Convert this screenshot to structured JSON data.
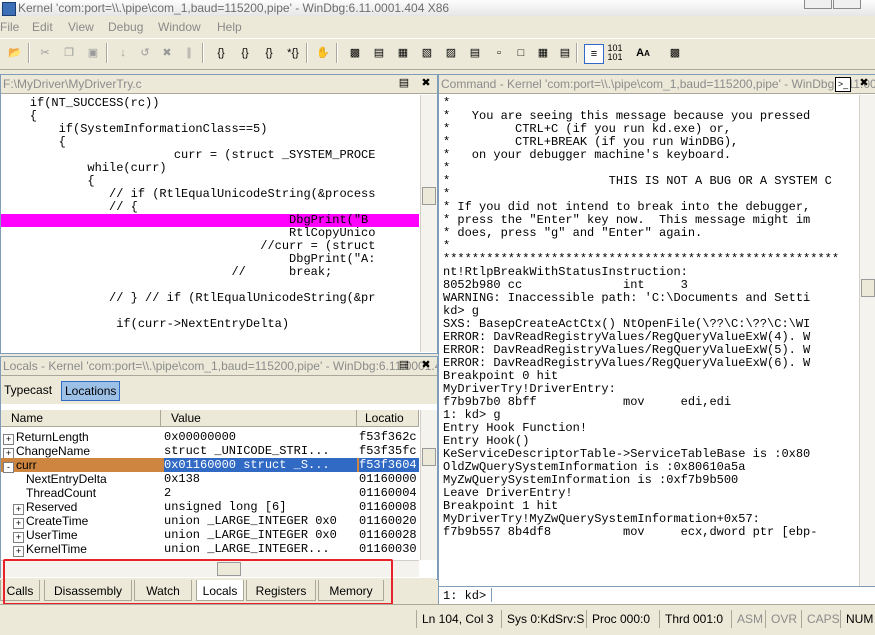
{
  "window": {
    "title": "Kernel 'com:port=\\\\.\\pipe\\com_1,baud=115200,pipe' - WinDbg:6.11.0001.404 X86"
  },
  "menu": [
    "File",
    "Edit",
    "View",
    "Debug",
    "Window",
    "Help"
  ],
  "toolbar": {
    "icons": [
      "open-folder-icon",
      "cut-icon",
      "copy-icon",
      "paste-icon",
      "go-icon",
      "restart-icon",
      "stop-icon",
      "break-icon",
      "step-into-icon",
      "step-over-icon",
      "step-out-icon",
      "run-to-cursor-icon",
      "hand-icon",
      "command-window-icon",
      "watch-window-icon",
      "locals-window-icon",
      "registers-window-icon",
      "memory-window-icon",
      "call-stack-icon",
      "disassembly-icon",
      "scratch-pad-icon",
      "process-threads-icon",
      "source-mode-icon",
      "hex-mode-icon",
      "font-icon",
      "options-icon"
    ]
  },
  "source": {
    "title": "F:\\MyDriver\\MyDriverTry.c",
    "lines": [
      "    if(NT_SUCCESS(rc))",
      "    {",
      "        if(SystemInformationClass==5)",
      "        {",
      "                        curr = (struct _SYSTEM_PROCE",
      "            while(curr)",
      "            {",
      "               // if (RtlEqualUnicodeString(&process",
      "               // {",
      "                                        DbgPrint(\"B",
      "                                        RtlCopyUnico",
      "                                    //curr = (struct",
      "                                        DbgPrint(\"A:",
      "                                //      break;",
      "",
      "               // } // if (RtlEqualUnicodeString(&pr",
      "",
      "                if(curr->NextEntryDelta)"
    ],
    "highlight_line": 9,
    "highlight_color": "#ff00ff"
  },
  "command": {
    "title": "Command - Kernel 'com:port=\\\\.\\pipe\\com_1,baud=115200,pipe' - WinDbg:6.11.0001.404 X86",
    "lines": [
      "*",
      "*   You are seeing this message because you pressed",
      "*         CTRL+C (if you run kd.exe) or,",
      "*         CTRL+BREAK (if you run WinDBG),",
      "*   on your debugger machine's keyboard.",
      "*",
      "*                      THIS IS NOT A BUG OR A SYSTEM C",
      "*",
      "* If you did not intend to break into the debugger,",
      "* press the \"Enter\" key now.  This message might im",
      "* does, press \"g\" and \"Enter\" again.",
      "*",
      "*******************************************************",
      "nt!RtlpBreakWithStatusInstruction:",
      "8052b980 cc              int     3",
      "WARNING: Inaccessible path: 'C:\\Documents and Setti",
      "kd> g",
      "SXS: BasepCreateActCtx() NtOpenFile(\\??\\C:\\??\\C:\\WI",
      "ERROR: DavReadRegistryValues/RegQueryValueExW(4). W",
      "ERROR: DavReadRegistryValues/RegQueryValueExW(5). W",
      "ERROR: DavReadRegistryValues/RegQueryValueExW(6). W",
      "Breakpoint 0 hit",
      "MyDriverTry!DriverEntry:",
      "f7b9b7b0 8bff            mov     edi,edi",
      "1: kd> g",
      "Entry Hook Function!",
      "Entry Hook()",
      "KeServiceDescriptorTable->ServiceTableBase is :0x80",
      "OldZwQuerySystemInformation is :0x80610a5a",
      "MyZwQuerySystemInformation is :0xf7b9b500",
      "Leave DriverEntry!",
      "Breakpoint 1 hit",
      "MyDriverTry!MyZwQuerySystemInformation+0x57:",
      "f7b9b557 8b4df8          mov     ecx,dword ptr [ebp-"
    ],
    "prompt": "1: kd>",
    "input_value": ""
  },
  "locals": {
    "title": "Locals - Kernel 'com:port=\\\\.\\pipe\\com_1,baud=115200,pipe' - WinDbg:6.11.0001.404 X86",
    "tabs": [
      "Typecast",
      "Locations"
    ],
    "columns": [
      "Name",
      "Value",
      "Locatio"
    ],
    "rows": [
      {
        "expander": "+",
        "indent": 0,
        "name": "ReturnLength",
        "value": "0x00000000",
        "loc": "f53f362c"
      },
      {
        "expander": "+",
        "indent": 0,
        "name": "ChangeName",
        "value": "struct _UNICODE_STRI...",
        "loc": "f53f35fc"
      },
      {
        "expander": "-",
        "indent": 0,
        "name": "curr",
        "value": "0x01160000 struct _S...",
        "loc": "f53f3604",
        "selected": true
      },
      {
        "expander": "",
        "indent": 1,
        "name": "NextEntryDelta",
        "value": "0x138",
        "loc": "01160000"
      },
      {
        "expander": "",
        "indent": 1,
        "name": "ThreadCount",
        "value": "2",
        "loc": "01160004"
      },
      {
        "expander": "+",
        "indent": 1,
        "name": "Reserved",
        "value": "unsigned long [6]",
        "loc": "01160008"
      },
      {
        "expander": "+",
        "indent": 1,
        "name": "CreateTime",
        "value": "union _LARGE_INTEGER 0x0",
        "loc": "01160020"
      },
      {
        "expander": "+",
        "indent": 1,
        "name": "UserTime",
        "value": "union _LARGE_INTEGER 0x0",
        "loc": "01160028"
      },
      {
        "expander": "+",
        "indent": 1,
        "name": "KernelTime",
        "value": "union _LARGE_INTEGER...",
        "loc": "01160030"
      }
    ]
  },
  "bottom_tabs": [
    "Calls",
    "Disassembly",
    "Watch",
    "Locals",
    "Registers",
    "Memory"
  ],
  "bottom_tabs_selected": "Locals",
  "status": {
    "position": "Ln 104, Col 3",
    "sys": "Sys 0:KdSrv:S",
    "proc": "Proc 000:0",
    "thrd": "Thrd 001:0",
    "asm": "ASM",
    "ovr": "OVR",
    "caps": "CAPS",
    "num": "NUM"
  },
  "colors": {
    "selected_row": "#cd853f",
    "selected_value": "#316ac5",
    "annotation_box": "#e8222b"
  }
}
